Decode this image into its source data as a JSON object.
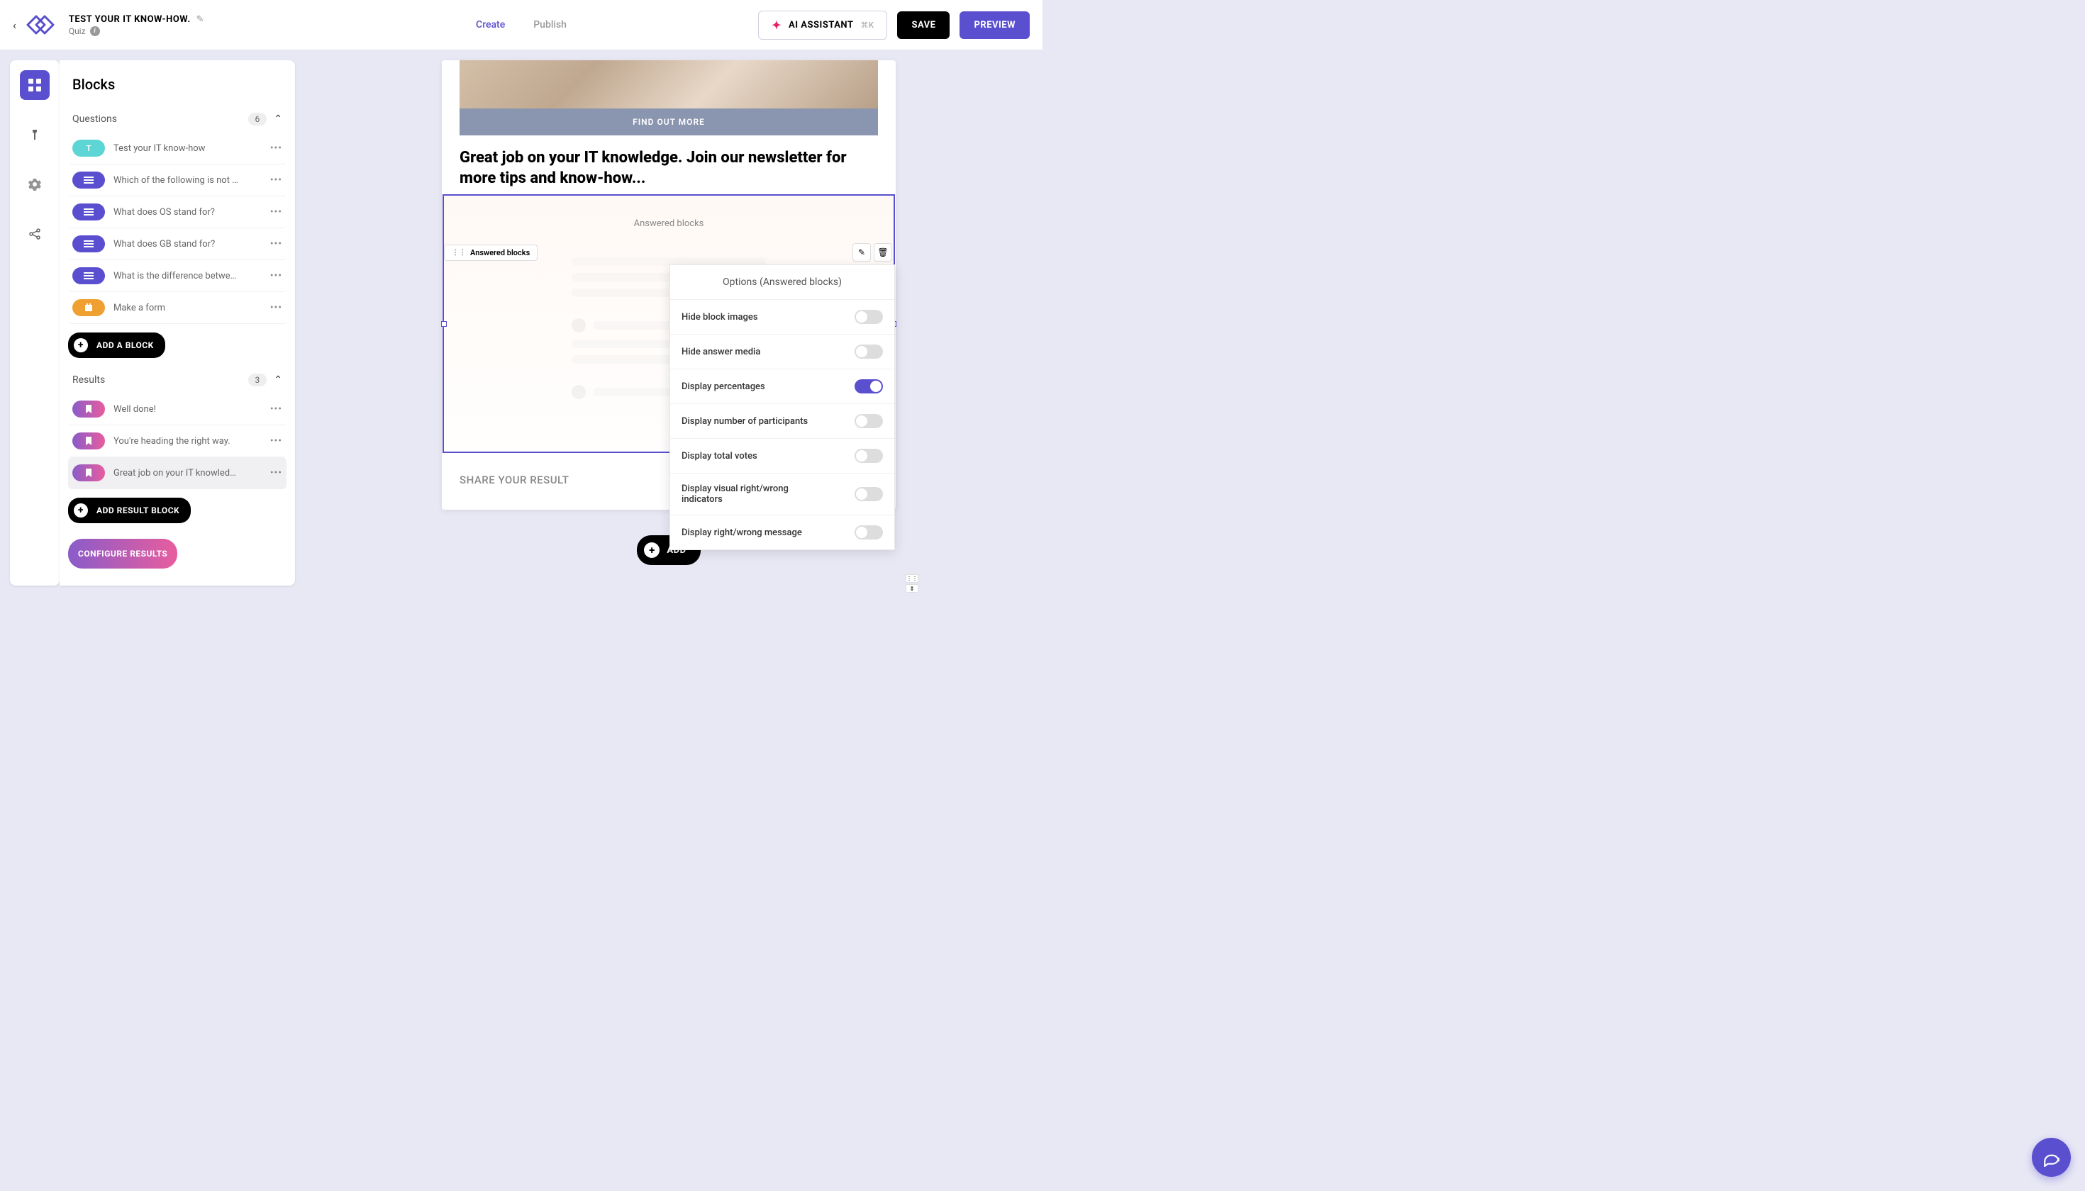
{
  "header": {
    "title": "TEST YOUR IT KNOW-HOW.",
    "subtitle": "Quiz",
    "tabs": {
      "create": "Create",
      "publish": "Publish"
    },
    "ai_label": "AI ASSISTANT",
    "ai_shortcut": "⌘K",
    "save": "SAVE",
    "preview": "PREVIEW"
  },
  "sidebar": {
    "title": "Blocks",
    "questions": {
      "label": "Questions",
      "count": "6",
      "items": [
        {
          "label": "Test your IT know-how",
          "badge": "T",
          "type": "teal"
        },
        {
          "label": "Which of the following is not …",
          "type": "purple"
        },
        {
          "label": "What does OS stand for?",
          "type": "purple"
        },
        {
          "label": "What does GB stand for?",
          "type": "purple"
        },
        {
          "label": "What is the difference betwe…",
          "type": "purple"
        },
        {
          "label": "Make a form",
          "type": "yellow"
        }
      ],
      "add": "ADD A BLOCK"
    },
    "results": {
      "label": "Results",
      "count": "3",
      "items": [
        {
          "label": "Well done!"
        },
        {
          "label": "You're heading the right way."
        },
        {
          "label": "Great job on your IT knowled…",
          "selected": true
        }
      ],
      "add": "ADD RESULT BLOCK",
      "configure": "CONFIGURE RESULTS"
    }
  },
  "canvas": {
    "find_out": "FIND OUT MORE",
    "headline": "Great job on your IT knowledge. Join our newsletter for more tips and know-how...",
    "answered_tag": "Answered blocks",
    "answered_label": "Answered blocks",
    "share": "SHARE YOUR RESULT",
    "add": "ADD"
  },
  "options": {
    "title": "Options (Answered blocks)",
    "rows": [
      {
        "label": "Hide block images",
        "on": false
      },
      {
        "label": "Hide answer media",
        "on": false
      },
      {
        "label": "Display percentages",
        "on": true
      },
      {
        "label": "Display number of participants",
        "on": false
      },
      {
        "label": "Display total votes",
        "on": false
      },
      {
        "label": "Display visual right/wrong indicators",
        "on": false
      },
      {
        "label": "Display right/wrong message",
        "on": false
      }
    ]
  }
}
